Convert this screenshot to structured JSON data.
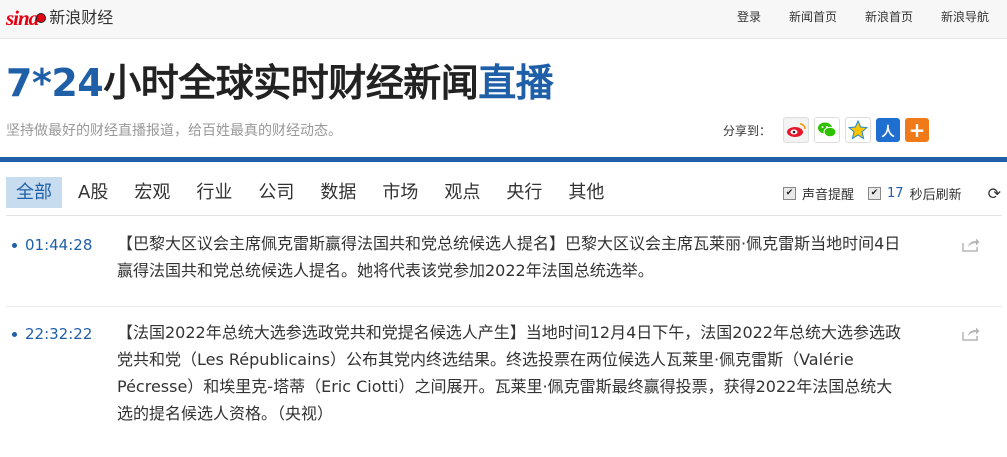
{
  "header": {
    "logo_mark": "sina",
    "logo_text": "新浪财经",
    "links": [
      "登录",
      "新闻首页",
      "新浪首页",
      "新浪导航"
    ]
  },
  "page": {
    "title_prefix": "7*24",
    "title_main": "小时全球实时财经新闻",
    "title_accent": "直播",
    "subtitle": "坚持做最好的财经直播报道，给百姓最真的财经动态。",
    "share_label": "分享到：",
    "share_icons": [
      "weibo-icon",
      "wechat-icon",
      "qzone-icon",
      "renren-icon",
      "more-share-icon"
    ]
  },
  "colors": {
    "accent": "#1f5fa8",
    "brand": "#e60012",
    "tab_active_bg": "#c8dcf0"
  },
  "tabs": [
    "全部",
    "A股",
    "宏观",
    "行业",
    "公司",
    "数据",
    "市场",
    "观点",
    "央行",
    "其他"
  ],
  "options": {
    "sound_label": "声音提醒",
    "sound_checked": true,
    "refresh_seconds": "17",
    "refresh_suffix": "秒后刷新",
    "refresh_checked": true
  },
  "feed": [
    {
      "time": "01:44:28",
      "text": "【巴黎大区议会主席佩克雷斯赢得法国共和党总统候选人提名】巴黎大区议会主席瓦莱丽·佩克雷斯当地时间4日赢得法国共和党总统候选人提名。她将代表该党参加2022年法国总统选举。"
    },
    {
      "time": "22:32:22",
      "text": "【法国2022年总统大选参选政党共和党提名候选人产生】当地时间12月4日下午，法国2022年总统大选参选政党共和党（Les Républicains）公布其党内终选结果。终选投票在两位候选人瓦莱里·佩克雷斯（Valérie Pécresse）和埃里克-塔蒂（Eric Ciotti）之间展开。瓦莱里·佩克雷斯最终赢得投票，获得2022年法国总统大选的提名候选人资格。（央视）"
    }
  ]
}
